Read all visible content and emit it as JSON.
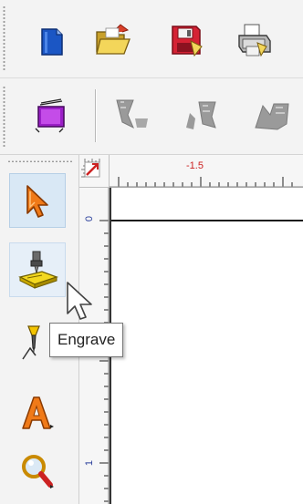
{
  "toolbars": {
    "file": {
      "buttons": [
        {
          "id": "new",
          "icon": "new-document-icon"
        },
        {
          "id": "open",
          "icon": "open-folder-icon"
        },
        {
          "id": "save",
          "icon": "save-disk-icon"
        },
        {
          "id": "print",
          "icon": "print-icon"
        }
      ]
    },
    "edit": {
      "buttons": [
        {
          "id": "frame",
          "icon": "frame-resize-icon"
        },
        {
          "id": "weld",
          "icon": "weld-icon",
          "enabled": false
        },
        {
          "id": "trim",
          "icon": "trim-icon",
          "enabled": false
        },
        {
          "id": "shape3",
          "icon": "shape-op-icon",
          "enabled": false
        }
      ]
    },
    "tools": {
      "buttons": [
        {
          "id": "select",
          "icon": "arrow-select-icon",
          "state": "active"
        },
        {
          "id": "engrave",
          "icon": "engrave-icon",
          "state": "hover"
        },
        {
          "id": "draw",
          "icon": "pen-draw-icon"
        },
        {
          "id": "text",
          "icon": "text-tool-icon"
        },
        {
          "id": "zoom",
          "icon": "magnifier-icon"
        }
      ]
    }
  },
  "rulers": {
    "horizontal_label": "-1.5",
    "vertical_labels": [
      "0",
      "1"
    ]
  },
  "tooltip": {
    "text": "Engrave"
  },
  "colors": {
    "toolbar_bg": "#f3f3f3",
    "active_button_bg": "#d9e8f5",
    "ruler_label_red": "#cc2222",
    "ruler_label_blue": "#2a3f9b"
  }
}
